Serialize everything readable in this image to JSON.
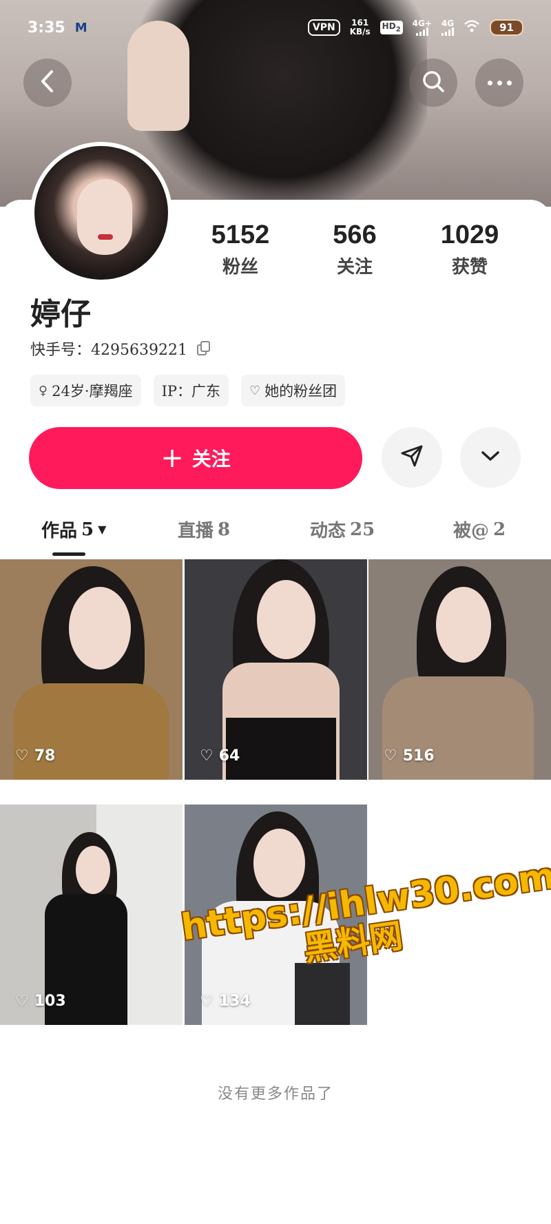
{
  "status_bar": {
    "time": "3:35",
    "app_badge": "M",
    "vpn": "VPN",
    "speed_value": "161",
    "speed_unit": "KB/s",
    "hd": "HD",
    "hd_sub": "2",
    "network_1": "4G+",
    "network_2": "4G",
    "battery": "91"
  },
  "header": {
    "back_icon": "chevron-left-icon",
    "search_icon": "search-icon",
    "more_icon": "more-horizontal-icon"
  },
  "profile": {
    "name": "婷仔",
    "id_label": "快手号：",
    "id_value": "4295639221",
    "stats": [
      {
        "value": "5152",
        "label": "粉丝"
      },
      {
        "value": "566",
        "label": "关注"
      },
      {
        "value": "1029",
        "label": "获赞"
      }
    ],
    "tags": [
      {
        "icon": "female-icon",
        "glyph": "♀",
        "text": "24岁·摩羯座"
      },
      {
        "icon": "",
        "glyph": "",
        "text": "IP：广东"
      },
      {
        "icon": "heart-icon",
        "glyph": "♡",
        "text": "她的粉丝团"
      }
    ]
  },
  "actions": {
    "follow_plus": "+",
    "follow_label": "关注",
    "share_icon": "send-icon",
    "dropdown_icon": "chevron-down-icon"
  },
  "tabs": [
    {
      "label": "作品",
      "count": "5",
      "active": true
    },
    {
      "label": "直播",
      "count": "8",
      "active": false
    },
    {
      "label": "动态",
      "count": "25",
      "active": false
    },
    {
      "label": "被@",
      "count": "2",
      "active": false
    }
  ],
  "videos": [
    {
      "likes": "78",
      "bg": "#9c7d5c"
    },
    {
      "likes": "64",
      "bg": "#3b3b40"
    },
    {
      "likes": "516",
      "bg": "#8a7f77"
    },
    {
      "likes": "103",
      "bg": "#c9c7c4"
    },
    {
      "likes": "134",
      "bg": "#7b7f88"
    }
  ],
  "watermark": {
    "url": "https://ihlw30.com",
    "site": "黑料网"
  },
  "footer": {
    "no_more": "没有更多作品了"
  },
  "colors": {
    "accent": "#fe1a5b",
    "text": "#222222",
    "muted": "#888888",
    "tag_bg": "#f4f4f4"
  }
}
